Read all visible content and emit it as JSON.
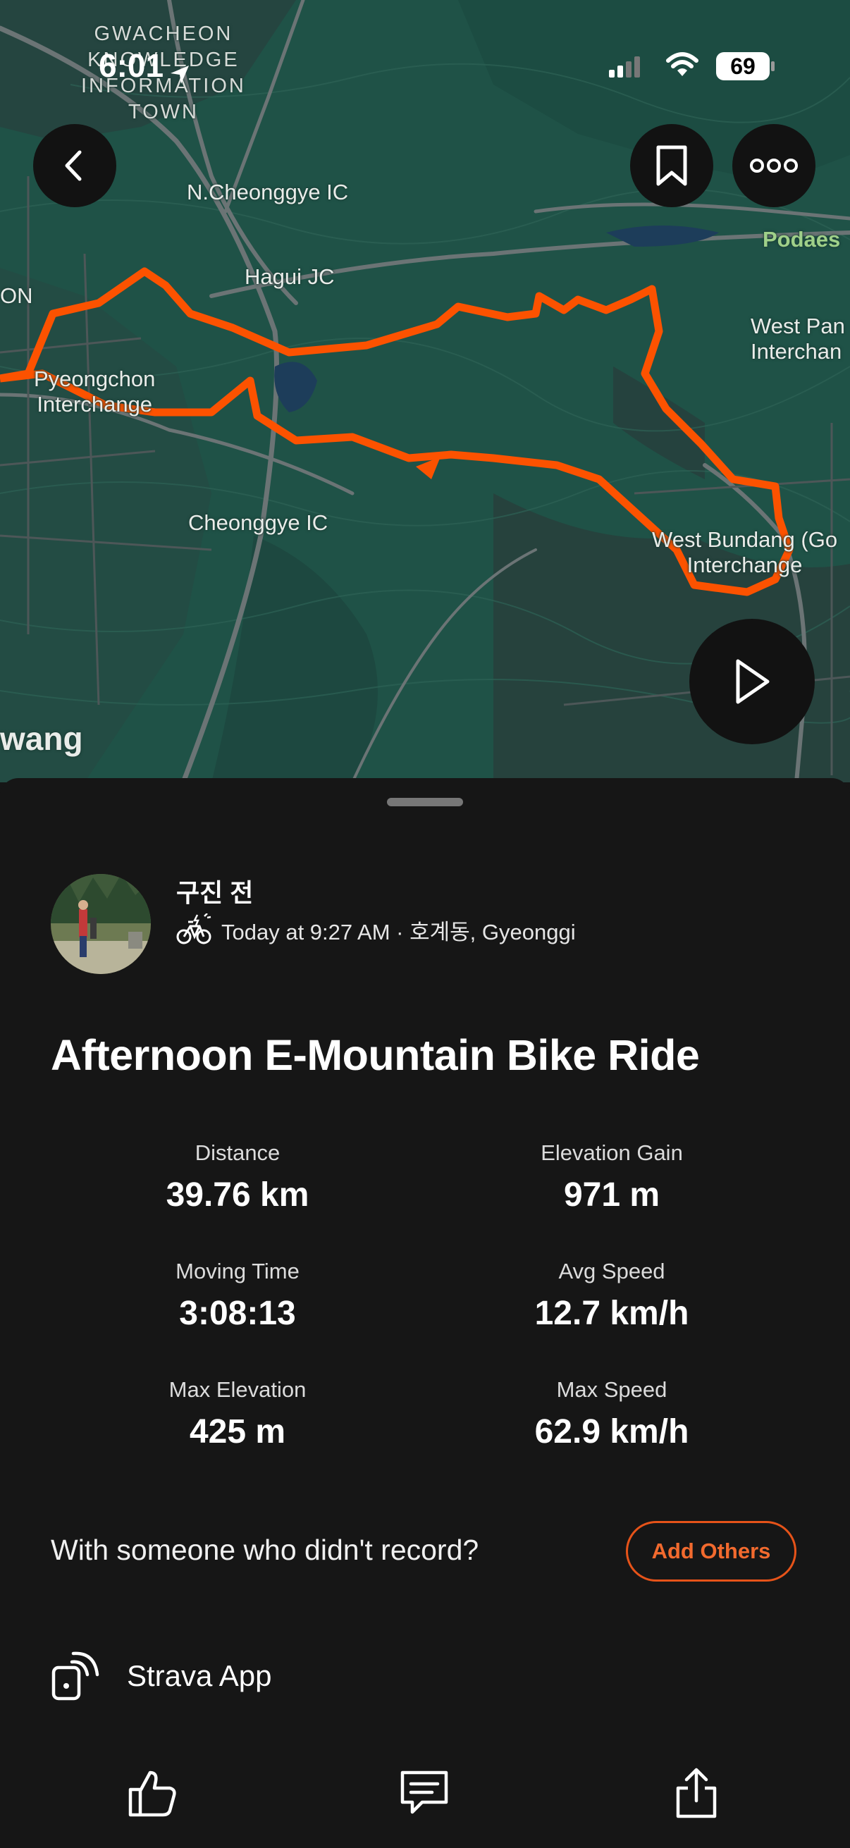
{
  "status_bar": {
    "time": "6:01",
    "battery": "69"
  },
  "map": {
    "labels": {
      "gwacheon": "GWACHEON\nKNOWLEDGE\nINFORMATION\nTOWN",
      "n_cheonggye": "N.Cheonggye IC",
      "hagui": "Hagui JC",
      "pyeongchon": "Pyeongchon\nInterchange",
      "cheonggye": "Cheonggye IC",
      "west_bundang": "West Bundang (Go\nInterchange",
      "west_pan": "West Pan\nInterchan",
      "podaes": "Podaes",
      "on": "ON",
      "wang": "wang"
    },
    "route_color": "#fc5200"
  },
  "activity": {
    "athlete_name": "구진 전",
    "meta": "Today at 9:27 AM · 호계동, Gyeonggi",
    "sport_icon": "e-mountain-bike-icon",
    "title": "Afternoon E-Mountain Bike Ride",
    "stats": [
      {
        "label": "Distance",
        "value": "39.76 km"
      },
      {
        "label": "Elevation Gain",
        "value": "971 m"
      },
      {
        "label": "Moving Time",
        "value": "3:08:13"
      },
      {
        "label": "Avg Speed",
        "value": "12.7 km/h"
      },
      {
        "label": "Max Elevation",
        "value": "425 m"
      },
      {
        "label": "Max Speed",
        "value": "62.9 km/h"
      }
    ]
  },
  "with_others": {
    "question": "With someone who didn't record?",
    "button": "Add Others"
  },
  "device": {
    "name": "Strava App",
    "icon": "device-broadcast-icon"
  },
  "actions": [
    "like-icon",
    "comment-icon",
    "share-icon"
  ],
  "colors": {
    "accent": "#fc5200",
    "background": "#161616",
    "map_base": "#1f5247"
  }
}
